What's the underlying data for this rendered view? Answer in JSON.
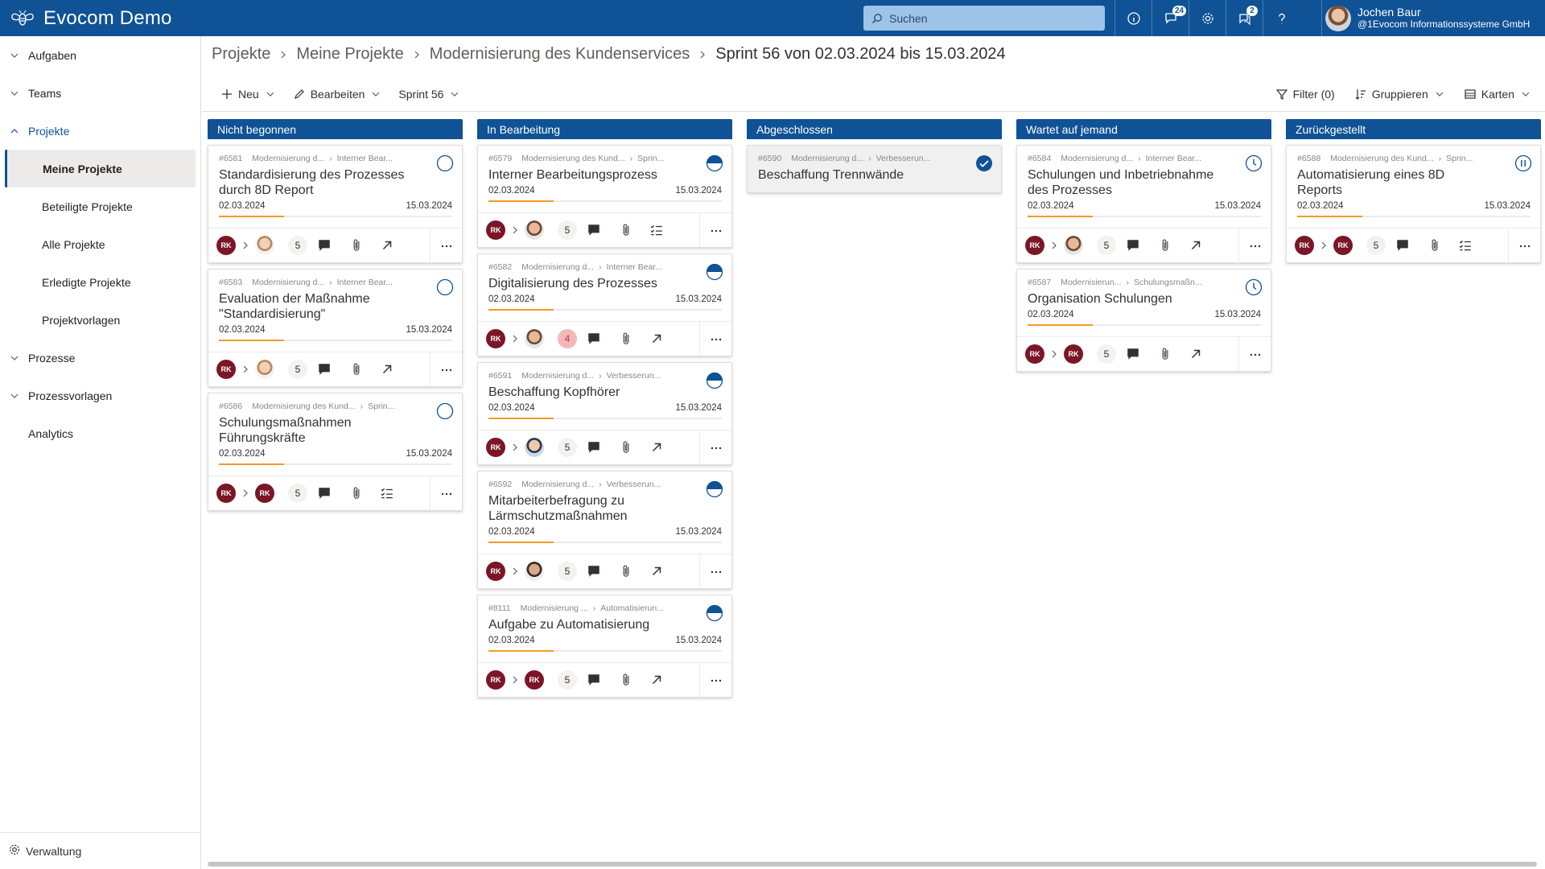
{
  "app": {
    "title": "Evocom Demo"
  },
  "search": {
    "placeholder": "Suchen"
  },
  "notifications": {
    "messages_badge": "24",
    "tasks_badge": "2"
  },
  "user": {
    "name": "Jochen Baur",
    "org": "@1Evocom Informationssysteme GmbH"
  },
  "sidebar": {
    "items": [
      {
        "label": "Aufgaben"
      },
      {
        "label": "Teams"
      },
      {
        "label": "Projekte"
      },
      {
        "label": "Meine Projekte"
      },
      {
        "label": "Beteiligte Projekte"
      },
      {
        "label": "Alle Projekte"
      },
      {
        "label": "Erledigte Projekte"
      },
      {
        "label": "Projektvorlagen"
      },
      {
        "label": "Prozesse"
      },
      {
        "label": "Prozessvorlagen"
      },
      {
        "label": "Analytics"
      }
    ],
    "bottom": "Verwaltung"
  },
  "breadcrumb": [
    "Projekte",
    "Meine Projekte",
    "Modernisierung des Kundenservices",
    "Sprint 56 von 02.03.2024 bis 15.03.2024"
  ],
  "toolbar": {
    "new": "Neu",
    "edit": "Bearbeiten",
    "sprint": "Sprint 56",
    "filter": "Filter (0)",
    "group": "Gruppieren",
    "view": "Karten"
  },
  "columns": [
    {
      "title": "Nicht begonnen",
      "cards": [
        {
          "id": "#6581",
          "project": "Modernisierung d...",
          "sub": "Interner Bear...",
          "title": "Standardisierung des Prozesses durch 8D Report",
          "start": "02.03.2024",
          "end": "15.03.2024",
          "count": "5",
          "progress": 0.28
        },
        {
          "id": "#6583",
          "project": "Modernisierung d...",
          "sub": "Interner Bear...",
          "title": "Evaluation der Maßnahme \"Standardisierung\"",
          "start": "02.03.2024",
          "end": "15.03.2024",
          "count": "5",
          "progress": 0.28
        },
        {
          "id": "#6586",
          "project": "Modernisierung des Kund...",
          "sub": "Sprin...",
          "title": "Schulungsmaßnahmen Führungskräfte",
          "start": "02.03.2024",
          "end": "15.03.2024",
          "count": "5",
          "progress": 0.28
        }
      ]
    },
    {
      "title": "In Bearbeitung",
      "cards": [
        {
          "id": "#6579",
          "project": "Modernisierung des Kund...",
          "sub": "Sprin...",
          "title": "Interner Bearbeitungsprozess",
          "start": "02.03.2024",
          "end": "15.03.2024",
          "count": "5",
          "progress": 0.28
        },
        {
          "id": "#6582",
          "project": "Modernisierung d...",
          "sub": "Interner Bear...",
          "title": "Digitalisierung des Prozesses",
          "start": "02.03.2024",
          "end": "15.03.2024",
          "count": "4",
          "progress": 0.28
        },
        {
          "id": "#6591",
          "project": "Modernisierung d...",
          "sub": "Verbesserun...",
          "title": "Beschaffung Kopfhörer",
          "start": "02.03.2024",
          "end": "15.03.2024",
          "count": "5",
          "progress": 0.28
        },
        {
          "id": "#6592",
          "project": "Modernisierung d...",
          "sub": "Verbesserun...",
          "title": "Mitarbeiterbefragung zu Lärmschutzmaßnahmen",
          "start": "02.03.2024",
          "end": "15.03.2024",
          "count": "5",
          "progress": 0.28
        },
        {
          "id": "#8111",
          "project": "Modernisierung ...",
          "sub": "Automatisierun...",
          "title": "Aufgabe zu Automatisierung",
          "start": "02.03.2024",
          "end": "15.03.2024",
          "count": "5",
          "progress": 0.28
        }
      ]
    },
    {
      "title": "Abgeschlossen",
      "cards": [
        {
          "id": "#6590",
          "project": "Modernisierung d...",
          "sub": "Verbesserun...",
          "title": "Beschaffung Trennwände"
        }
      ]
    },
    {
      "title": "Wartet auf jemand",
      "cards": [
        {
          "id": "#6584",
          "project": "Modernisierung d...",
          "sub": "Interner Bear...",
          "title": "Schulungen und Inbetriebnahme des Prozesses",
          "start": "02.03.2024",
          "end": "15.03.2024",
          "count": "5",
          "progress": 0.28
        },
        {
          "id": "#6587",
          "project": "Modernisierun...",
          "sub": "Schulungsmaßn...",
          "title": "Organisation Schulungen",
          "start": "02.03.2024",
          "end": "15.03.2024",
          "count": "5",
          "progress": 0.28
        }
      ]
    },
    {
      "title": "Zurückgestellt",
      "cards": [
        {
          "id": "#6588",
          "project": "Modernisierung des Kund...",
          "sub": "Sprin...",
          "title": "Automatisierung eines 8D Reports",
          "start": "02.03.2024",
          "end": "15.03.2024",
          "count": "5",
          "progress": 0.28
        }
      ]
    }
  ],
  "avatar_initials": "RK",
  "colors": {
    "brand": "#0f5296",
    "progress": "#f39a26",
    "assignee": "#7b1627"
  }
}
